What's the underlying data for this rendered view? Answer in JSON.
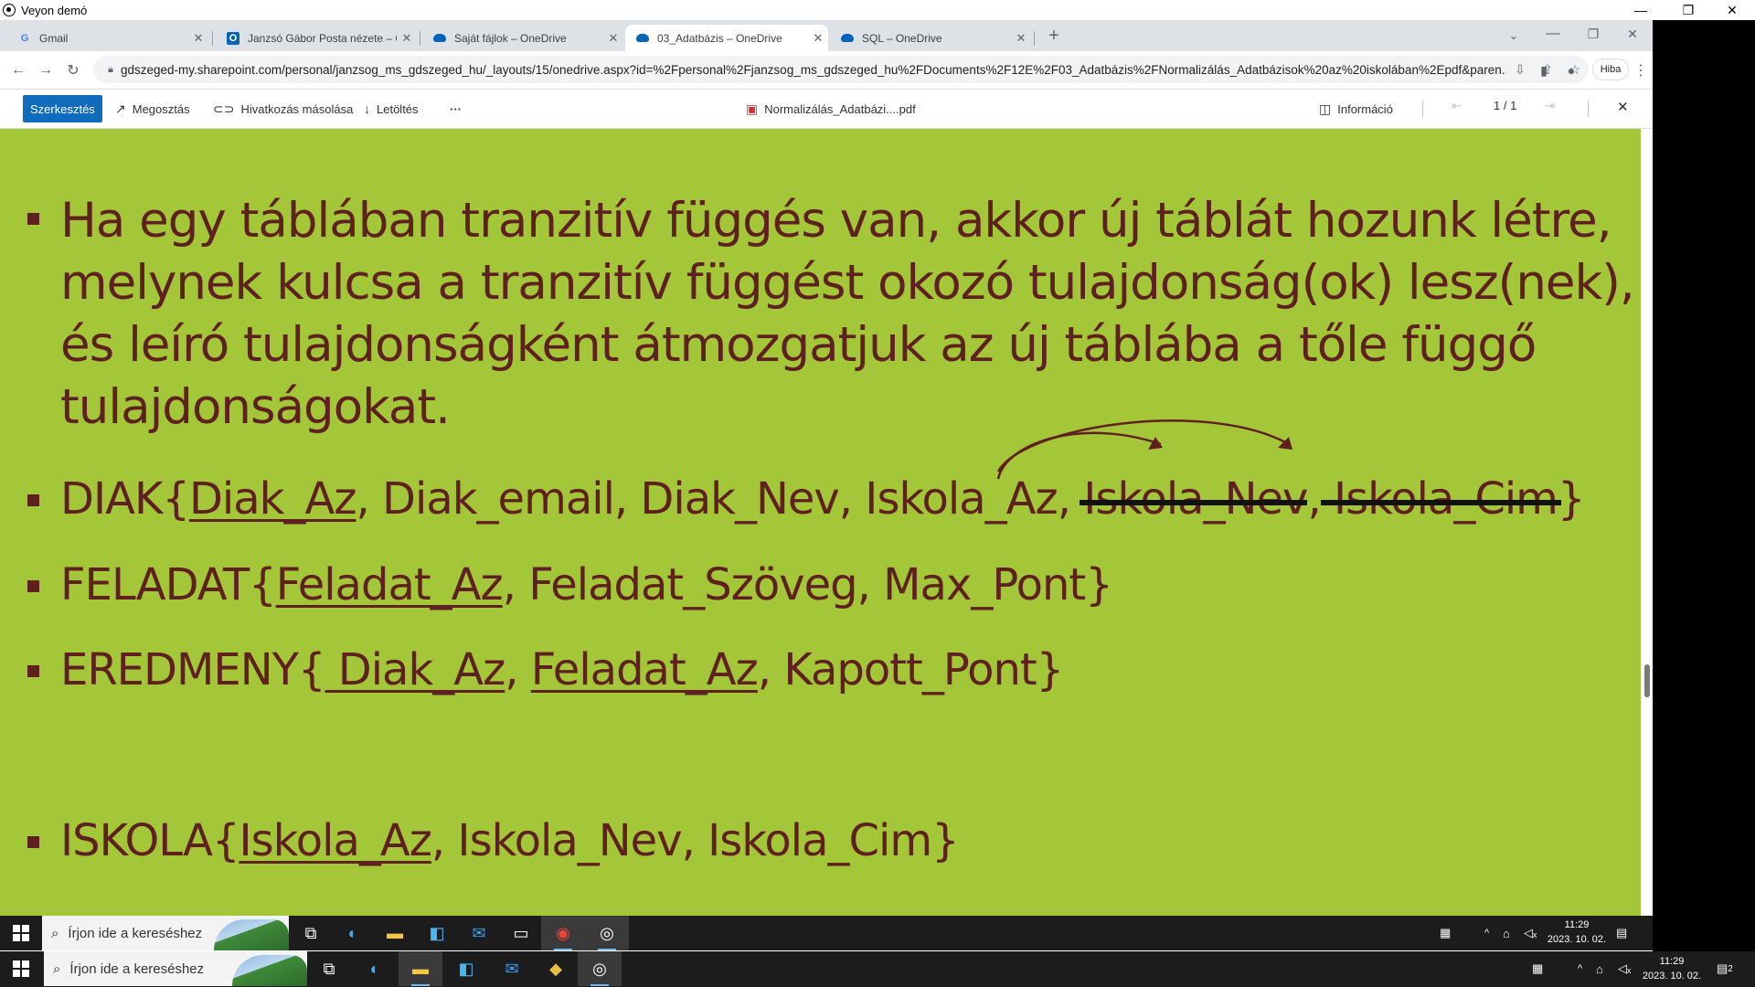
{
  "veyon": {
    "title": "Veyon demó"
  },
  "tabs": [
    {
      "title": "Gmail",
      "icon": "G"
    },
    {
      "title": "Janzsó Gábor Posta nézete – Ou",
      "icon": "O"
    },
    {
      "title": "Saját fájlok – OneDrive",
      "icon": "cloud"
    },
    {
      "title": "03_Adatbázis – OneDrive",
      "icon": "cloud"
    },
    {
      "title": "SQL – OneDrive",
      "icon": "cloud"
    }
  ],
  "omnibox": {
    "url": "gdszeged-my.sharepoint.com/personal/janzsog_ms_gdszeged_hu/_layouts/15/onedrive.aspx?id=%2Fpersonal%2Fjanzsog_ms_gdszeged_hu%2FDocuments%2F12E%2F03_Adatbázis%2FNormalizálás_Adatbázisok%20az%20iskolában%2Epdf&paren..."
  },
  "profile": {
    "error_label": "Hiba"
  },
  "commandbar": {
    "edit": "Szerkesztés",
    "share": "Megosztás",
    "copy_link": "Hivatkozás másolása",
    "download": "Letöltés",
    "more": "···",
    "filename": "Normalizálás_Adatbázi....pdf",
    "info": "Információ",
    "page": "1 / 1"
  },
  "slide": {
    "para_lines": [
      "Ha egy táblában tranzitív függés van, akkor új táblát hozunk létre,",
      "melynek kulcsa a tranzitív függést okozó tulajdonság(ok) lesz(nek),",
      "és leíró tulajdonságként átmozgatjuk az új táblába a tőle függő",
      "tulajdonságokat."
    ],
    "diak": {
      "prefix": "DIAK{",
      "key": "Diak_Az",
      "rest": ", Diak_email, Diak_Nev, Iskola_Az, ",
      "struck1": "Iskola_Nev",
      "comma": ", ",
      "struck2": "Iskola_Cim",
      "end": "}"
    },
    "feladat": {
      "prefix": "FELADAT{",
      "key": "Feladat_Az",
      "rest": ", Feladat_Szöveg, Max_Pont}"
    },
    "eredmeny": {
      "prefix": "EREDMENY{",
      "key1": " Diak_Az",
      "sep": ", ",
      "key2": "Feladat_Az",
      "rest": ", Kapott_Pont}"
    },
    "iskola": {
      "prefix": "ISKOLA{",
      "key": "Iskola_Az",
      "rest": ", Iskola_Nev, Iskola_Cim}"
    }
  },
  "taskbar": {
    "search_placeholder": "Írjon ide a kereséshez",
    "time": "11:29",
    "date": "2023. 10. 02.",
    "notifications": "2"
  },
  "colors": {
    "slide_bg": "#a4c639",
    "slide_text": "#5f2020",
    "accent": "#0f6cbd"
  }
}
